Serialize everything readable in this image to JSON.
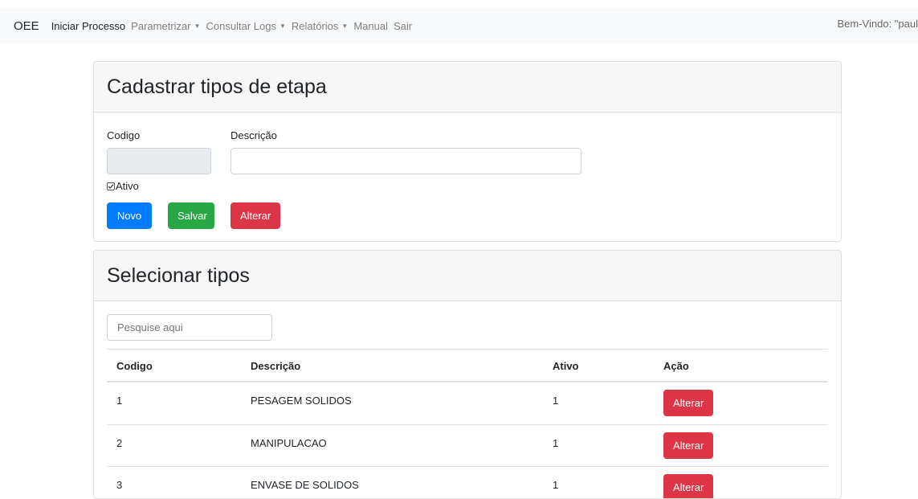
{
  "navbar": {
    "brand": "OEE",
    "items": [
      {
        "label": "Iniciar Processo",
        "dropdown": false,
        "active": true
      },
      {
        "label": "Parametrizar",
        "dropdown": true,
        "active": false
      },
      {
        "label": "Consultar Logs",
        "dropdown": true,
        "active": false
      },
      {
        "label": "Relatórios",
        "dropdown": true,
        "active": false
      },
      {
        "label": "Manual",
        "dropdown": false,
        "active": false
      },
      {
        "label": "Sair",
        "dropdown": false,
        "active": false
      }
    ],
    "welcome": "Bem-Vindo: \"paul"
  },
  "form_card": {
    "title": "Cadastrar tipos de etapa",
    "codigo_label": "Codigo",
    "codigo_value": "",
    "descricao_label": "Descrição",
    "descricao_value": "",
    "ativo_label": "Ativo",
    "ativo_checked": true,
    "buttons": {
      "novo": "Novo",
      "salvar": "Salvar",
      "alterar": "Alterar"
    }
  },
  "list_card": {
    "title": "Selecionar tipos",
    "search_placeholder": "Pesquise aqui",
    "columns": [
      "Codigo",
      "Descrição",
      "Ativo",
      "Ação"
    ],
    "rows": [
      {
        "codigo": "1",
        "descricao": "PESAGEM SOLIDOS",
        "ativo": "1",
        "acao": "Alterar"
      },
      {
        "codigo": "2",
        "descricao": "MANIPULACAO",
        "ativo": "1",
        "acao": "Alterar"
      },
      {
        "codigo": "3",
        "descricao": "ENVASE DE SOLIDOS",
        "ativo": "1",
        "acao": "Alterar"
      }
    ]
  },
  "colors": {
    "primary": "#007bff",
    "success": "#28a745",
    "danger": "#dc3545",
    "navbar_bg": "#f8f9fa"
  },
  "icons": {
    "dropdown": "caret-down-icon",
    "checkbox": "check-icon"
  }
}
